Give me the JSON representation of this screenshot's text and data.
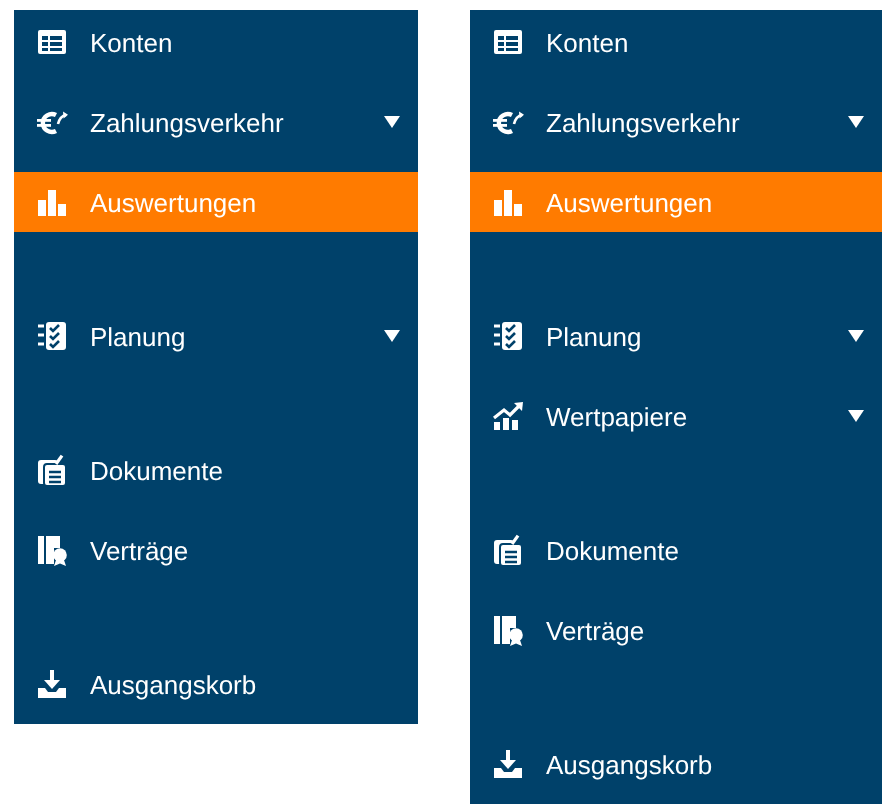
{
  "panels": [
    {
      "groups": [
        [
          {
            "label": "Konten",
            "kind": "table",
            "expandable": false,
            "selected": false
          },
          {
            "label": "Zahlungsverkehr",
            "kind": "euro",
            "expandable": true,
            "selected": false
          },
          {
            "label": "Auswertungen",
            "kind": "bars",
            "expandable": false,
            "selected": true
          }
        ],
        [
          {
            "label": "Planung",
            "kind": "checklist",
            "expandable": true,
            "selected": false
          }
        ],
        [
          {
            "label": "Dokumente",
            "kind": "clipboard",
            "expandable": false,
            "selected": false
          },
          {
            "label": "Verträge",
            "kind": "contract",
            "expandable": false,
            "selected": false
          }
        ],
        [
          {
            "label": "Ausgangskorb",
            "kind": "tray",
            "expandable": false,
            "selected": false
          }
        ]
      ]
    },
    {
      "groups": [
        [
          {
            "label": "Konten",
            "kind": "table",
            "expandable": false,
            "selected": false
          },
          {
            "label": "Zahlungsverkehr",
            "kind": "euro",
            "expandable": true,
            "selected": false
          },
          {
            "label": "Auswertungen",
            "kind": "bars",
            "expandable": false,
            "selected": true
          }
        ],
        [
          {
            "label": "Planung",
            "kind": "checklist",
            "expandable": true,
            "selected": false
          },
          {
            "label": "Wertpapiere",
            "kind": "trend",
            "expandable": true,
            "selected": false
          }
        ],
        [
          {
            "label": "Dokumente",
            "kind": "clipboard",
            "expandable": false,
            "selected": false
          },
          {
            "label": "Verträge",
            "kind": "contract",
            "expandable": false,
            "selected": false
          }
        ],
        [
          {
            "label": "Ausgangskorb",
            "kind": "tray",
            "expandable": false,
            "selected": false
          }
        ]
      ]
    }
  ]
}
